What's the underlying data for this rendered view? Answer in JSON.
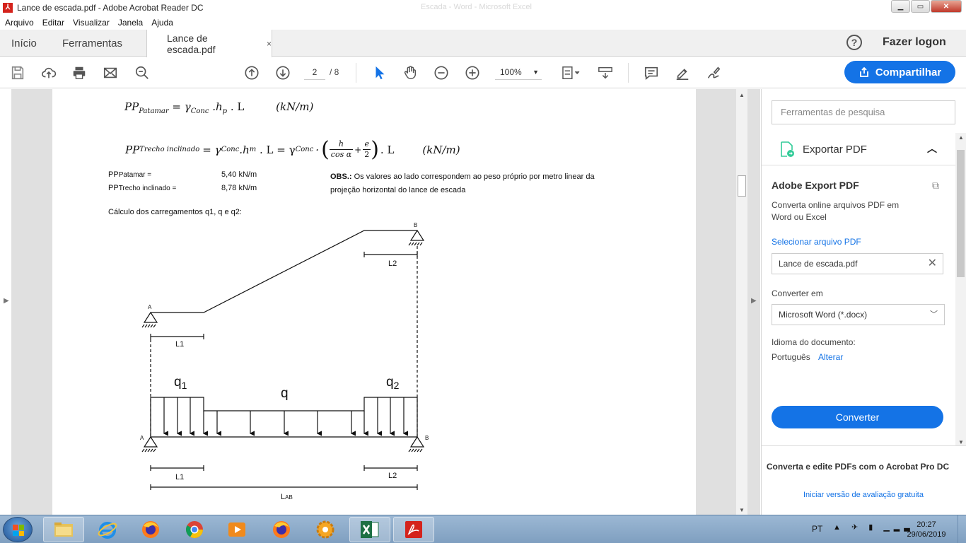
{
  "window": {
    "title": "Lance de escada.pdf - Adobe Acrobat Reader DC",
    "ghost_title": "Escada - Word - Microsoft Excel",
    "minimize": "▁",
    "maximize": "▭",
    "close": "✕"
  },
  "menu": [
    "Arquivo",
    "Editar",
    "Visualizar",
    "Janela",
    "Ajuda"
  ],
  "tabs": {
    "home": "Início",
    "tools": "Ferramentas",
    "doc": "Lance de escada.pdf",
    "doc_close": "×"
  },
  "header": {
    "help": "?",
    "login": "Fazer logon"
  },
  "toolbar": {
    "page_current": "2",
    "page_total": "/ 8",
    "zoom": "100%",
    "share": "Compartilhar",
    "icons": [
      "save-icon",
      "cloud-upload-icon",
      "print-icon",
      "email-icon",
      "search-zoom-icon",
      "page-up-icon",
      "page-down-icon",
      "select-pointer-icon",
      "hand-tool-icon",
      "zoom-out-icon",
      "zoom-in-icon",
      "page-fit-icon",
      "scroll-mode-icon",
      "comment-icon",
      "highlight-pen-icon",
      "sign-icon"
    ]
  },
  "document": {
    "formula1": {
      "lhs": "PP",
      "lhs_sub": "Patamar",
      "rhs": "= γ",
      "rhs_sub1": "Conc",
      "mid": " .h",
      "mid_sub": "p",
      "end": " . L",
      "unit": "(kN/m)"
    },
    "formula2": {
      "lhs": "PP",
      "lhs_sub": "Trecho inclinado",
      "part1": "= γ",
      "sub1": "Conc",
      "part2": " .h",
      "sub2": "m",
      "part3": " . L = γ",
      "sub3": "Conc",
      "frac_h": "h",
      "frac_cos": "cos α",
      "plus": "+",
      "frac_e": "e",
      "frac_2": "2",
      "part4": ". L",
      "unit": "(kN/m)"
    },
    "pp_rows": [
      {
        "label": "PP",
        "label_sub": "Patamar =",
        "value": "5,40  kN/m"
      },
      {
        "label": "PP",
        "label_sub": "Trecho inclinado =",
        "value": "8,78  kN/m"
      }
    ],
    "obs_bold": "OBS.:",
    "obs_text": " Os valores ao lado correspondem ao peso próprio por metro linear da projeção horizontal do lance de escada",
    "calc_heading": "Cálculo dos carregamentos q1, q e q2:",
    "diagram_labels": {
      "A_top": "A",
      "B_top": "B",
      "L1_top": "L1",
      "L2_top": "L2",
      "q1": "q",
      "q1_sub": "1",
      "q": "q",
      "q2": "q",
      "q2_sub": "2",
      "A_bottom": "A",
      "B_bottom": "B",
      "L1_bottom": "L1",
      "L2_bottom": "L2",
      "LAB": "L",
      "LAB_sub": "AB"
    }
  },
  "right_panel": {
    "search_placeholder": "Ferramentas de pesquisa",
    "export_title": "Exportar PDF",
    "adobe_export": "Adobe Export PDF",
    "description": "Converta online arquivos PDF em Word ou Excel",
    "select_file": "Selecionar arquivo PDF",
    "file_name": "Lance de escada.pdf",
    "convert_in": "Converter em",
    "format": "Microsoft Word (*.docx)",
    "lang_label": "Idioma do documento:",
    "lang_value": "Português",
    "lang_change": "Alterar",
    "convert_button": "Converter",
    "promo": "Converta e edite PDFs com o Acrobat Pro DC",
    "promo_link": "Iniciar versão de avaliação gratuita"
  },
  "taskbar": {
    "apps": [
      "file-explorer-icon",
      "internet-explorer-icon",
      "firefox-icon",
      "chrome-icon",
      "media-player-icon",
      "firefox-icon",
      "settings-app-icon",
      "excel-icon",
      "acrobat-icon"
    ],
    "lang": "PT",
    "time": "20:27",
    "date": "29/06/2019"
  },
  "colors": {
    "accent": "#1473e6",
    "acrobat_red": "#d4231c"
  }
}
